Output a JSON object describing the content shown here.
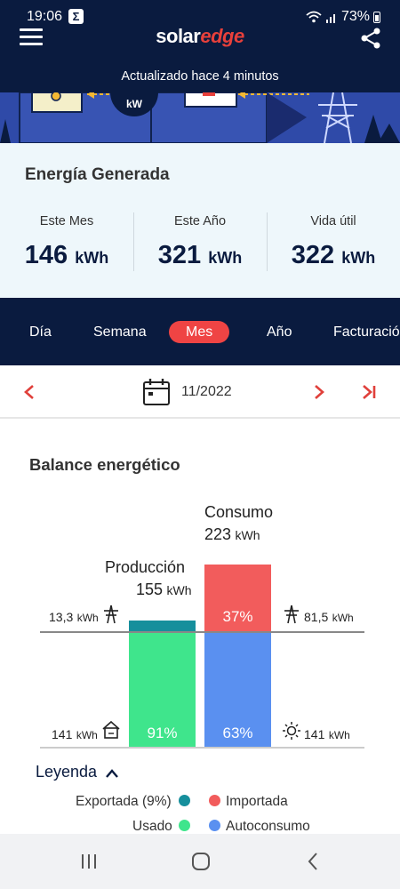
{
  "status_bar": {
    "time": "19:06",
    "notif_badge": "Σ",
    "battery": "73%"
  },
  "header": {
    "logo_solar": "solar",
    "logo_edge": "edge",
    "updated": "Actualizado hace 4 minutos",
    "icons": [
      "menu-icon",
      "share-icon"
    ]
  },
  "banner": {
    "power_unit": "kW"
  },
  "energy": {
    "title": "Energía Generada",
    "columns": [
      {
        "label": "Este Mes",
        "value": "146",
        "unit": "kWh"
      },
      {
        "label": "Este Año",
        "value": "321",
        "unit": "kWh"
      },
      {
        "label": "Vida útil",
        "value": "322",
        "unit": "kWh"
      }
    ]
  },
  "tabs": [
    "Día",
    "Semana",
    "Mes",
    "Año",
    "Facturación"
  ],
  "active_tab": "Mes",
  "date_nav": {
    "date": "11/2022"
  },
  "balance": {
    "title": "Balance energético",
    "consumo_label": "Consumo",
    "consumo_value": "223",
    "produccion_label": "Producción",
    "produccion_value": "155",
    "unit": "kWh",
    "grid_export": "13,3",
    "grid_import": "81,5",
    "home_used": "141",
    "self_consumption": "141",
    "exported_pct": "37%",
    "import_pct": "37%",
    "used_pct": "91%",
    "self_pct": "63%"
  },
  "legend": {
    "title": "Leyenda",
    "items": [
      {
        "label": "Exportada (9%)",
        "color": "#168f9c"
      },
      {
        "label": "Importada",
        "color": "#f25c5c"
      },
      {
        "label": "Usado",
        "color": "#3fe58c"
      },
      {
        "label": "Autoconsumo",
        "color": "#5a90f0"
      }
    ]
  },
  "colors": {
    "navy": "#0a1b3f",
    "accent_red": "#ef4444",
    "export_teal": "#168f9c",
    "used_green": "#3fe58c",
    "import_red": "#f25c5c",
    "self_blue": "#5a90f0"
  }
}
